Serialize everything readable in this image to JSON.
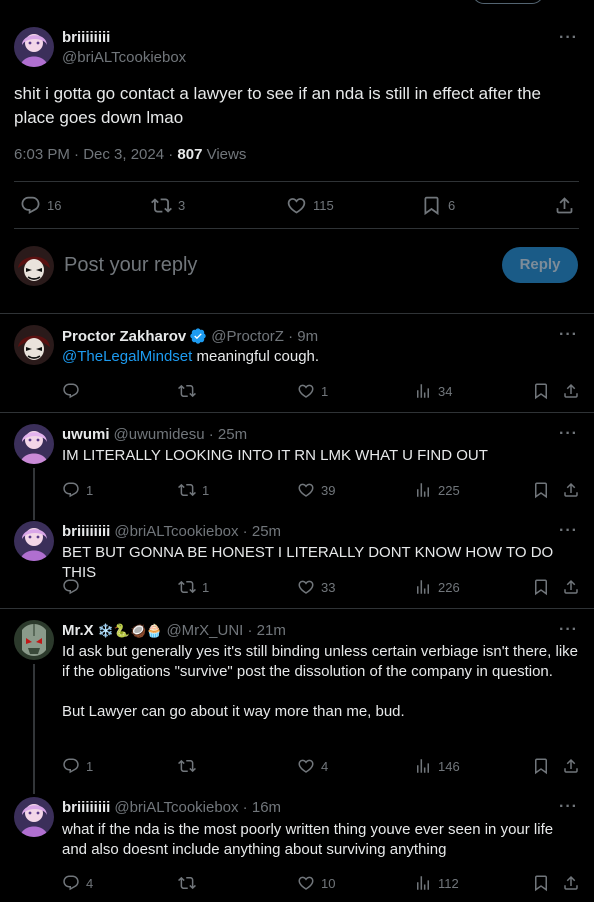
{
  "main": {
    "author_name": "briiiiiiii",
    "author_handle": "@briALTcookiebox",
    "text": "shit i gotta go contact a lawyer to see if an nda is still in effect after the place goes down lmao",
    "time": "6:03 PM · Dec 3, 2024 · ",
    "views_count": "807",
    "views_label": " Views",
    "replies": "16",
    "reposts": "3",
    "likes": "115",
    "bookmarks": "6"
  },
  "composer": {
    "placeholder": "Post your reply",
    "reply_label": "Reply"
  },
  "replies": [
    {
      "name": "Proctor Zakharov",
      "verified": true,
      "handle": "@ProctorZ · 9m",
      "mention": "@TheLegalMindset",
      "text": " meaningful cough.",
      "reply_count": "",
      "repost_count": "",
      "like_count": "1",
      "views": "34"
    },
    {
      "name": "uwumi",
      "handle": "@uwumidesu · 25m",
      "text": "IM LITERALLY LOOKING INTO IT RN LMK WHAT U FIND OUT",
      "reply_count": "1",
      "repost_count": "1",
      "like_count": "39",
      "views": "225"
    },
    {
      "name": "briiiiiiii",
      "handle": "@briALTcookiebox · 25m",
      "text": "BET BUT GONNA BE HONEST I LITERALLY DONT KNOW HOW TO DO THIS",
      "reply_count": "",
      "repost_count": "1",
      "like_count": "33",
      "views": "226"
    },
    {
      "name": "Mr.X",
      "emojis": "❄️🐍🥥🧁",
      "handle": "@MrX_UNI · 21m",
      "text": "Id ask but generally yes it's still binding unless certain verbiage isn't there, like if the obligations \"survive\" post the dissolution of the company in question.\n\nBut Lawyer can go about it way more than me, bud.",
      "reply_count": "1",
      "repost_count": "",
      "like_count": "4",
      "views": "146"
    },
    {
      "name": "briiiiiiii",
      "handle": "@briALTcookiebox · 16m",
      "text": "what if the nda is the most poorly written thing youve ever seen in your life and also doesnt include anything about surviving anything",
      "reply_count": "4",
      "repost_count": "",
      "like_count": "10",
      "views": "112"
    }
  ],
  "colors": {
    "accent": "#1d9bf0",
    "muted": "#71767b",
    "border": "#2f3336"
  }
}
